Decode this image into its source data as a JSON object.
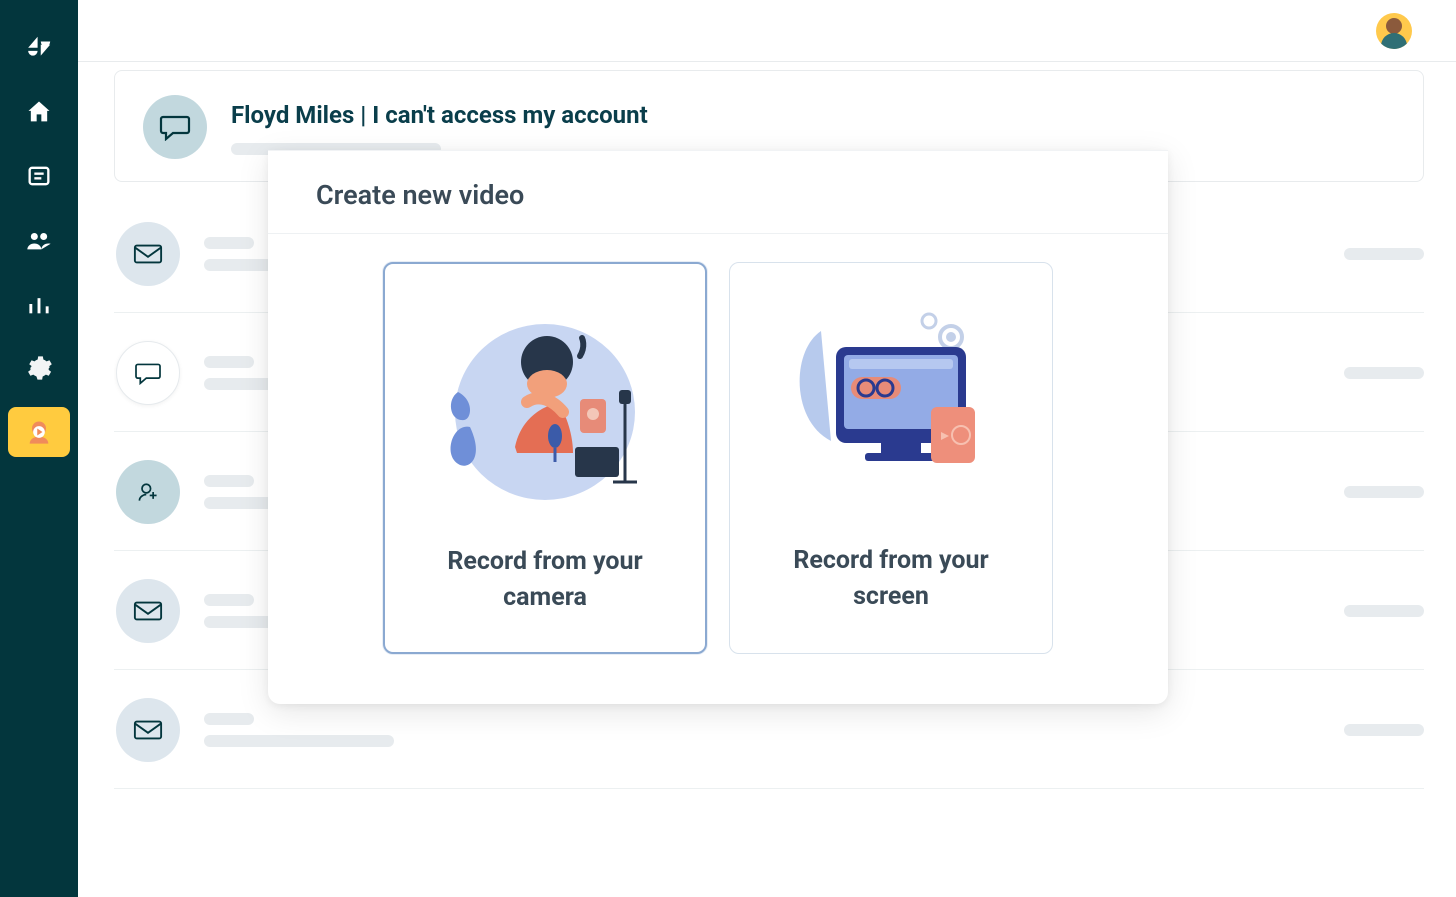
{
  "ticket": {
    "name": "Floyd Miles",
    "subject": "I can't access my account"
  },
  "panel": {
    "title": "Create new video",
    "options": {
      "camera": "Record from your camera",
      "screen": "Record from your screen"
    }
  }
}
